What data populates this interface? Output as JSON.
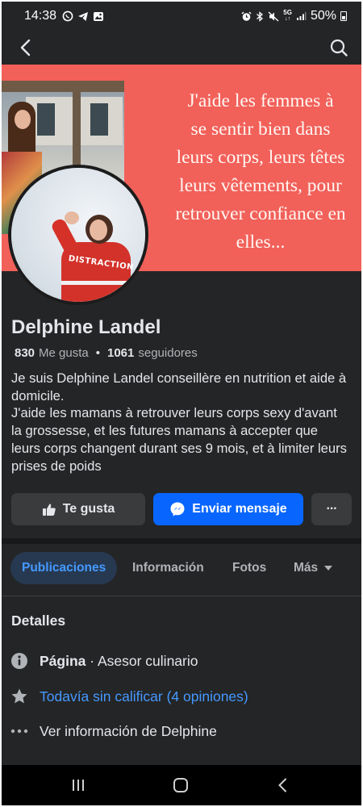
{
  "status_bar": {
    "time": "14:38",
    "battery": "50%",
    "network": "5G",
    "left_icons": [
      "whatsapp-icon",
      "telegram-icon",
      "gallery-icon"
    ],
    "right_icons": [
      "alarm-icon",
      "bluetooth-icon",
      "mute-icon",
      "5g-icon",
      "signal-icon",
      "battery-icon"
    ]
  },
  "nav": {
    "back_icon": "arrow-left-icon",
    "search_icon": "search-icon"
  },
  "cover": {
    "text": "J'aide les femmes à\nse sentir bien dans\nleurs corps, leurs têtes\nleurs vêtements, pour\nretrouver confiance en\nelles..."
  },
  "profile": {
    "name": "Delphine Landel",
    "likes_count": "830",
    "likes_label": "Me gusta",
    "followers_count": "1061",
    "followers_label": "seguidores",
    "bio": "Je suis Delphine Landel conseillère en nutrition et aide à domicile.\nJ'aide les mamans à retrouver leurs corps sexy d'avant la grossesse, et les futures mamans à accepter que leurs corps changent durant ses 9 mois, et à limiter leurs prises de poids"
  },
  "actions": {
    "like_label": "Te gusta",
    "message_label": "Enviar mensaje",
    "more_label": "···"
  },
  "tabs": [
    {
      "label": "Publicaciones",
      "active": true
    },
    {
      "label": "Información",
      "active": false
    },
    {
      "label": "Fotos",
      "active": false
    },
    {
      "label": "Más",
      "active": false
    }
  ],
  "details": {
    "title": "Detalles",
    "page_label": "Página",
    "page_separator": " · ",
    "page_category": "Asesor culinario",
    "rating": "Todavía sin calificar (4 opiniones)",
    "more_info": "Ver información de Delphine"
  },
  "colors": {
    "background": "#242526",
    "accent_blue": "#0866ff",
    "link_blue": "#4599ff",
    "cover_red": "#f2605a"
  }
}
